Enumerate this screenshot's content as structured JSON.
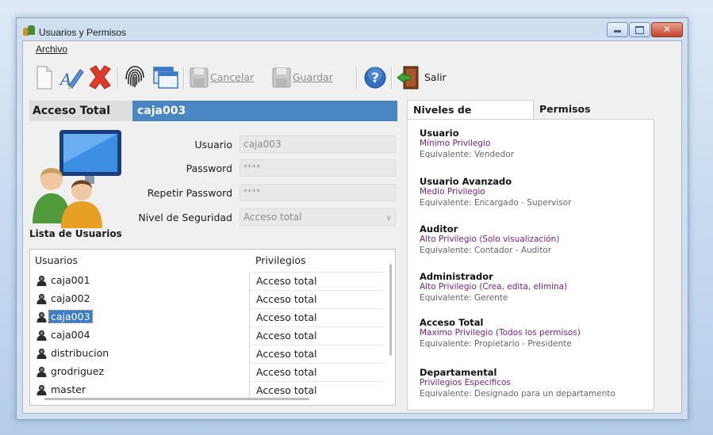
{
  "window": {
    "title": "Usuarios y Permisos",
    "close_glyph": "✕"
  },
  "menu": {
    "archivo": "Archivo"
  },
  "toolbar": {
    "new_icon": "new-document-icon",
    "edit_icon": "edit-pencil-icon",
    "delete_icon": "delete-x-icon",
    "fingerprint_icon": "fingerprint-icon",
    "windows_icon": "windows-icon",
    "cancel_label": "Cancelar",
    "save_label": "Guardar",
    "help_icon": "help-icon",
    "help_glyph": "?",
    "exit_label": "Salir"
  },
  "header": {
    "label": "Acceso Total",
    "user": "caja003"
  },
  "form": {
    "usuario_label": "Usuario",
    "usuario_value": "caja003",
    "password_label": "Password",
    "password_value": "****",
    "repeat_label": "Repetir Password",
    "repeat_value": "****",
    "nivel_label": "Nivel de Seguridad",
    "nivel_value": "Acceso total"
  },
  "users_list": {
    "title": "Lista de Usuarios",
    "col_users": "Usuarios",
    "col_privs": "Privilegios",
    "rows": [
      {
        "name": "caja001",
        "priv": "Acceso total"
      },
      {
        "name": "caja002",
        "priv": "Acceso total"
      },
      {
        "name": "caja003",
        "priv": "Acceso total"
      },
      {
        "name": "caja004",
        "priv": "Acceso total"
      },
      {
        "name": "distribucion",
        "priv": "Acceso total"
      },
      {
        "name": "grodriguez",
        "priv": "Acceso total"
      },
      {
        "name": "master",
        "priv": "Acceso total"
      }
    ],
    "selected": "caja003"
  },
  "tabs": {
    "niveles": "Niveles de Seguridad",
    "permisos": "Permisos"
  },
  "levels": [
    {
      "name": "Usuario",
      "priv": "Mínimo Privilegio",
      "eq": "Equivalente:  Vendedor"
    },
    {
      "name": "Usuario Avanzado",
      "priv": "Medio Privilegio",
      "eq": "Equivalente:  Encargado - Supervisor"
    },
    {
      "name": "Auditor",
      "priv": "Alto Privilegio (Solo visualización)",
      "eq": "Equivalente:  Contador - Auditor"
    },
    {
      "name": "Administrador",
      "priv": "Alto Privilegio (Crea, edita, elimina)",
      "eq": "Equivalente:  Gerente"
    },
    {
      "name": "Acceso Total",
      "priv": "Maximo Privilegio (Todos los permisos)",
      "eq": "Equivalente:  Propietario - Presidente"
    },
    {
      "name": "Departamental",
      "priv": "Privilegios Especificos",
      "eq": "Equivalente:  Designado para un departamento"
    }
  ],
  "colors": {
    "header_blue": "#4a87c2",
    "selection": "#3c7cc8",
    "privilege_purple": "#7b1f8a"
  }
}
